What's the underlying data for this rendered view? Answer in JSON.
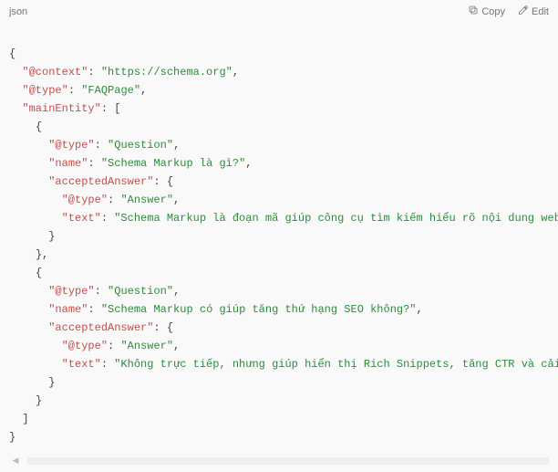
{
  "header": {
    "lang": "json",
    "copy_label": "Copy",
    "edit_label": "Edit"
  },
  "code": {
    "l1": "{",
    "l2a": "\"@context\"",
    "l2b": ": ",
    "l2c": "\"https://schema.org\"",
    "l2d": ",",
    "l3a": "\"@type\"",
    "l3b": ": ",
    "l3c": "\"FAQPage\"",
    "l3d": ",",
    "l4a": "\"mainEntity\"",
    "l4b": ": [",
    "l5": "{",
    "l6a": "\"@type\"",
    "l6b": ": ",
    "l6c": "\"Question\"",
    "l6d": ",",
    "l7a": "\"name\"",
    "l7b": ": ",
    "l7c": "\"Schema Markup là gì?\"",
    "l7d": ",",
    "l8a": "\"acceptedAnswer\"",
    "l8b": ": {",
    "l9a": "\"@type\"",
    "l9b": ": ",
    "l9c": "\"Answer\"",
    "l9d": ",",
    "l10a": "\"text\"",
    "l10b": ": ",
    "l10c": "\"Schema Markup là đoạn mã giúp công cụ tìm kiếm hiểu rõ nội dung website hơn.\"",
    "l11": "}",
    "l12": "},",
    "l13": "{",
    "l14a": "\"@type\"",
    "l14b": ": ",
    "l14c": "\"Question\"",
    "l14d": ",",
    "l15a": "\"name\"",
    "l15b": ": ",
    "l15c": "\"Schema Markup có giúp tăng thứ hạng SEO không?\"",
    "l15d": ",",
    "l16a": "\"acceptedAnswer\"",
    "l16b": ": {",
    "l17a": "\"@type\"",
    "l17b": ": ",
    "l17c": "\"Answer\"",
    "l17d": ",",
    "l18a": "\"text\"",
    "l18b": ": ",
    "l18c": "\"Không trực tiếp, nhưng giúp hiển thị Rich Snippets, tăng CTR và cải thiện SEO.\"",
    "l19": "}",
    "l20": "}",
    "l21": "]",
    "l22": "}"
  }
}
